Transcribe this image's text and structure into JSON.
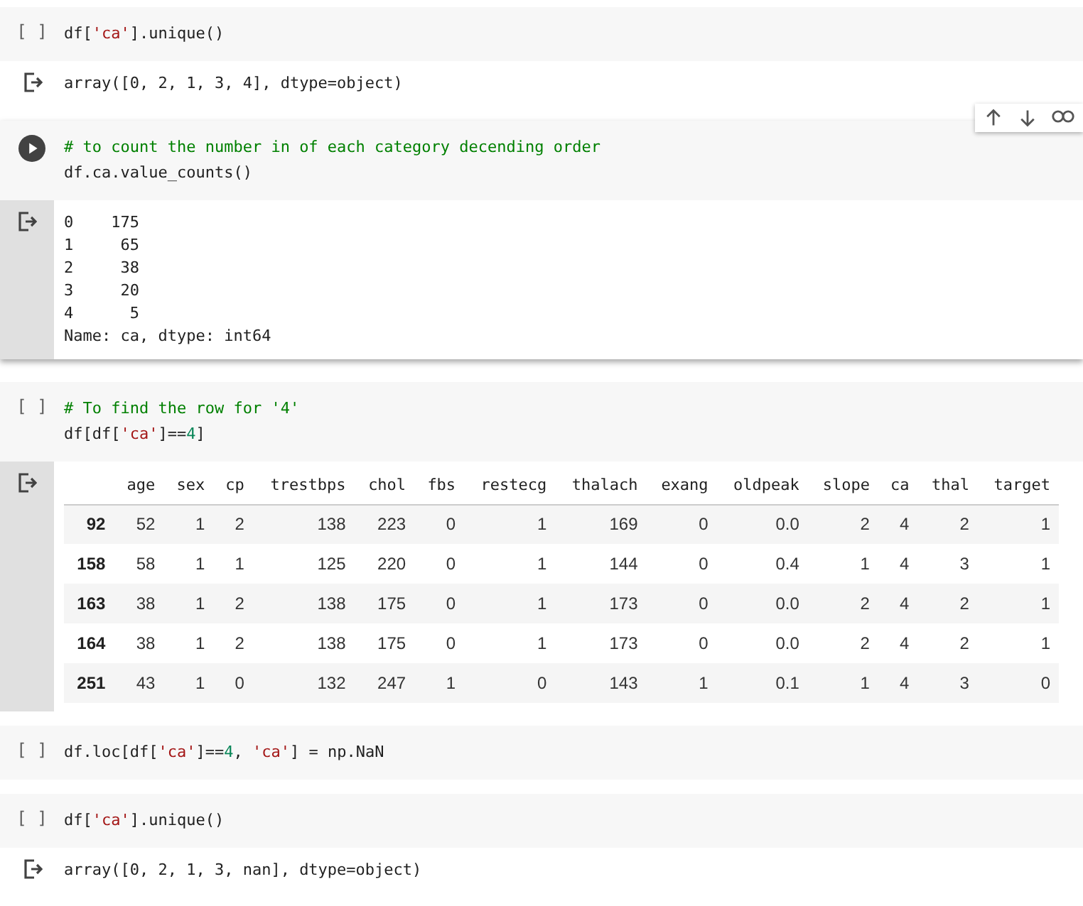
{
  "cells": [
    {
      "prompt": "[ ]",
      "focused": false,
      "lines": [
        [
          {
            "kind": "code",
            "t": "df["
          },
          {
            "kind": "string",
            "t": "'ca'"
          },
          {
            "kind": "code",
            "t": "].unique()"
          }
        ]
      ],
      "output": {
        "kind": "text",
        "shaded": false,
        "lines": [
          "array([0, 2, 1, 3, 4], dtype=object)"
        ]
      }
    },
    {
      "focused": true,
      "lines": [
        [
          {
            "kind": "comment",
            "t": "# to count the number in of each category decending order"
          }
        ],
        [
          {
            "kind": "code",
            "t": "df.ca.value_counts()"
          }
        ]
      ],
      "output": {
        "kind": "text",
        "shaded": true,
        "lines": [
          "0    175",
          "1     65",
          "2     38",
          "3     20",
          "4      5",
          "Name: ca, dtype: int64"
        ]
      }
    },
    {
      "prompt": "[ ]",
      "focused": false,
      "lines": [
        [
          {
            "kind": "comment",
            "t": "# To find the row for '4'"
          }
        ],
        [
          {
            "kind": "code",
            "t": "df[df["
          },
          {
            "kind": "string",
            "t": "'ca'"
          },
          {
            "kind": "code",
            "t": "]=="
          },
          {
            "kind": "number",
            "t": "4"
          },
          {
            "kind": "code",
            "t": "]"
          }
        ]
      ],
      "output": {
        "kind": "table",
        "shaded": true,
        "columns": [
          "age",
          "sex",
          "cp",
          "trestbps",
          "chol",
          "fbs",
          "restecg",
          "thalach",
          "exang",
          "oldpeak",
          "slope",
          "ca",
          "thal",
          "target"
        ],
        "rows": [
          {
            "index": "92",
            "cells": [
              "52",
              "1",
              "2",
              "138",
              "223",
              "0",
              "1",
              "169",
              "0",
              "0.0",
              "2",
              "4",
              "2",
              "1"
            ]
          },
          {
            "index": "158",
            "cells": [
              "58",
              "1",
              "1",
              "125",
              "220",
              "0",
              "1",
              "144",
              "0",
              "0.4",
              "1",
              "4",
              "3",
              "1"
            ]
          },
          {
            "index": "163",
            "cells": [
              "38",
              "1",
              "2",
              "138",
              "175",
              "0",
              "1",
              "173",
              "0",
              "0.0",
              "2",
              "4",
              "2",
              "1"
            ]
          },
          {
            "index": "164",
            "cells": [
              "38",
              "1",
              "2",
              "138",
              "175",
              "0",
              "1",
              "173",
              "0",
              "0.0",
              "2",
              "4",
              "2",
              "1"
            ]
          },
          {
            "index": "251",
            "cells": [
              "43",
              "1",
              "0",
              "132",
              "247",
              "1",
              "0",
              "143",
              "1",
              "0.1",
              "1",
              "4",
              "3",
              "0"
            ]
          }
        ]
      }
    },
    {
      "prompt": "[ ]",
      "focused": false,
      "lines": [
        [
          {
            "kind": "code",
            "t": "df.loc[df["
          },
          {
            "kind": "string",
            "t": "'ca'"
          },
          {
            "kind": "code",
            "t": "]=="
          },
          {
            "kind": "number",
            "t": "4"
          },
          {
            "kind": "code",
            "t": ", "
          },
          {
            "kind": "string",
            "t": "'ca'"
          },
          {
            "kind": "code",
            "t": "] = np.NaN"
          }
        ]
      ]
    },
    {
      "prompt": "[ ]",
      "focused": false,
      "lines": [
        [
          {
            "kind": "code",
            "t": "df["
          },
          {
            "kind": "string",
            "t": "'ca'"
          },
          {
            "kind": "code",
            "t": "].unique()"
          }
        ]
      ],
      "output": {
        "kind": "text",
        "shaded": false,
        "lines": [
          "array([0, 2, 1, 3, nan], dtype=object)"
        ]
      }
    }
  ]
}
